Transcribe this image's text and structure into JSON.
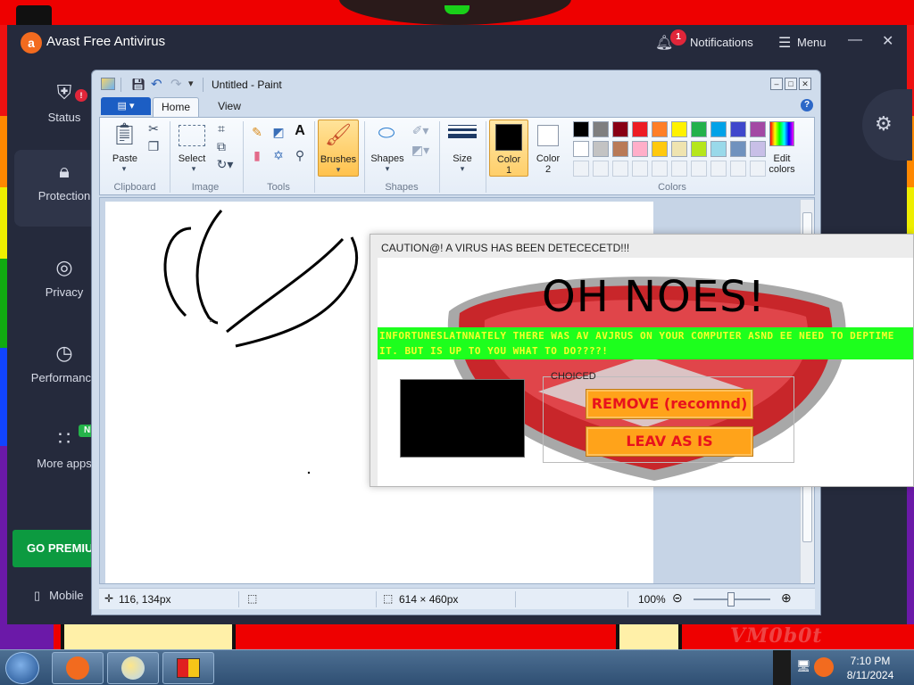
{
  "avast": {
    "title": "Avast Free Antivirus",
    "notifications_count": "1",
    "notifications_label": "Notifications",
    "menu_label": "Menu",
    "nav": [
      {
        "label": "Status",
        "icon": "shield-alert-icon"
      },
      {
        "label": "Protection",
        "icon": "lock-icon"
      },
      {
        "label": "Privacy",
        "icon": "fingerprint-icon"
      },
      {
        "label": "Performance",
        "icon": "speedometer-icon"
      },
      {
        "label": "More apps",
        "icon": "grid-icon"
      }
    ],
    "status_badge": "!",
    "new_badge": "NE",
    "go_premium": "GO PREMIU",
    "mobile_label": "Mobile"
  },
  "paint": {
    "title": "Untitled - Paint",
    "tabs": [
      "Home",
      "View"
    ],
    "clipboard": {
      "paste": "Paste",
      "group": "Clipboard"
    },
    "image": {
      "select": "Select",
      "group": "Image"
    },
    "tools": {
      "group": "Tools"
    },
    "brushes": "Brushes",
    "shapes": {
      "label": "Shapes",
      "group": "Shapes"
    },
    "size": "Size",
    "color1": {
      "line1": "Color",
      "line2": "1"
    },
    "color2": {
      "line1": "Color",
      "line2": "2"
    },
    "colors_group": "Colors",
    "edit_colors": {
      "line1": "Edit",
      "line2": "colors"
    },
    "palette_row1": [
      "#000000",
      "#7f7f7f",
      "#880015",
      "#ed1c24",
      "#ff7f27",
      "#fff200",
      "#22b14c",
      "#00a2e8",
      "#3f48cc",
      "#a349a4"
    ],
    "palette_row2": [
      "#ffffff",
      "#c3c3c3",
      "#b97a57",
      "#ffaec9",
      "#ffc90e",
      "#efe4b0",
      "#b5e61d",
      "#99d9ea",
      "#7092be",
      "#c8bfe7"
    ],
    "color1_value": "#000000",
    "color2_value": "#ffffff",
    "status": {
      "cursor_pos": "116, 134px",
      "canvas_size": "614 × 460px",
      "zoom": "100%"
    }
  },
  "popup": {
    "title": "CAUTION@! A VIRUS HAS BEEN DETECECETD!!!",
    "heading": "OH NOES!",
    "banner": "INFORTUNESLATNNATELY THERE WAS AV AVJRUS ON YOUR COMPUTER ASND EE NEED TO DEPTIME IT. BUT IS UP TO YOU WHAT TO DO????!",
    "choice_legend": "CHOICED",
    "remove_button": "REMOVE (recomnd)",
    "leave_button": "LEAV AS IS"
  },
  "wallpaper": {
    "signature": "VM0b0t"
  },
  "taskbar": {
    "time": "7:10 PM",
    "date": "8/11/2024",
    "apps": [
      "avast-app",
      "paint-app",
      "windows-explorer-app"
    ]
  }
}
